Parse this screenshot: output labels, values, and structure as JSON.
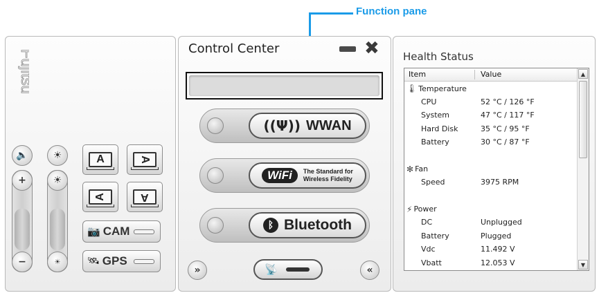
{
  "annotation": {
    "label": "Function pane"
  },
  "left_panel": {
    "logo_text": "Fujitsu",
    "cam_label": "CAM",
    "gps_label": "GPS",
    "rotate_buttons": [
      "A",
      "A",
      "A",
      "A"
    ]
  },
  "center_panel": {
    "title": "Control Center",
    "wwan_label": "WWAN",
    "wifi_logo": "WiFi",
    "wifi_tagline_1": "The Standard for",
    "wifi_tagline_2": "Wireless Fidelity",
    "bluetooth_label": "Bluetooth",
    "nav_left": "»",
    "nav_right": "«"
  },
  "right_panel": {
    "title": "Health Status",
    "columns": [
      "Item",
      "Value"
    ],
    "sections": [
      {
        "category": "Temperature",
        "icon": "thermometer-icon",
        "rows": [
          {
            "item": "CPU",
            "value": "52 °C / 126 °F"
          },
          {
            "item": "System",
            "value": "47 °C / 117 °F"
          },
          {
            "item": "Hard Disk",
            "value": "35 °C / 95 °F"
          },
          {
            "item": "Battery",
            "value": "30 °C / 87 °F"
          }
        ]
      },
      {
        "category": "Fan",
        "icon": "fan-icon",
        "rows": [
          {
            "item": "Speed",
            "value": "3975 RPM"
          }
        ]
      },
      {
        "category": "Power",
        "icon": "power-icon",
        "rows": [
          {
            "item": "DC",
            "value": "Unplugged"
          },
          {
            "item": "Battery",
            "value": "Plugged"
          },
          {
            "item": "Vdc",
            "value": "11.492 V"
          },
          {
            "item": "Vbatt",
            "value": "12.053 V"
          }
        ]
      }
    ]
  },
  "colors": {
    "annotation": "#1a9be8",
    "panel_border": "#b9b9b9"
  }
}
